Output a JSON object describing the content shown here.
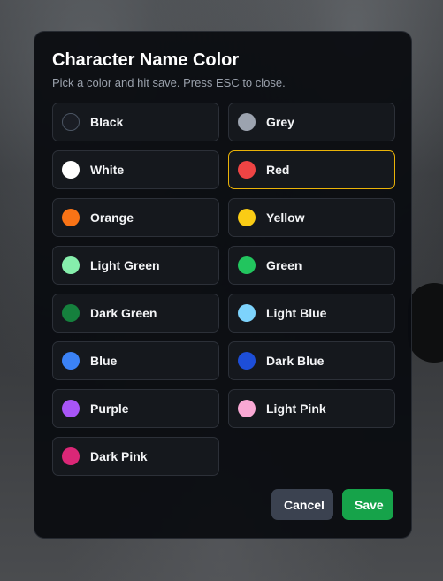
{
  "modal": {
    "title": "Character Name Color",
    "subtitle": "Pick a color and hit save. Press ESC to close.",
    "options": [
      {
        "label": "Black",
        "color": "#1a1d24",
        "outlined": true,
        "selected": false
      },
      {
        "label": "Grey",
        "color": "#9ca3af",
        "outlined": false,
        "selected": false
      },
      {
        "label": "White",
        "color": "#ffffff",
        "outlined": false,
        "selected": false
      },
      {
        "label": "Red",
        "color": "#ef4444",
        "outlined": false,
        "selected": true
      },
      {
        "label": "Orange",
        "color": "#f97316",
        "outlined": false,
        "selected": false
      },
      {
        "label": "Yellow",
        "color": "#facc15",
        "outlined": false,
        "selected": false
      },
      {
        "label": "Light Green",
        "color": "#86efac",
        "outlined": false,
        "selected": false
      },
      {
        "label": "Green",
        "color": "#22c55e",
        "outlined": false,
        "selected": false
      },
      {
        "label": "Dark Green",
        "color": "#15803d",
        "outlined": false,
        "selected": false
      },
      {
        "label": "Light Blue",
        "color": "#7dd3fc",
        "outlined": false,
        "selected": false
      },
      {
        "label": "Blue",
        "color": "#3b82f6",
        "outlined": false,
        "selected": false
      },
      {
        "label": "Dark Blue",
        "color": "#1d4ed8",
        "outlined": false,
        "selected": false
      },
      {
        "label": "Purple",
        "color": "#a855f7",
        "outlined": false,
        "selected": false
      },
      {
        "label": "Light Pink",
        "color": "#f9a8d4",
        "outlined": false,
        "selected": false
      },
      {
        "label": "Dark Pink",
        "color": "#db2777",
        "outlined": false,
        "selected": false
      }
    ],
    "cancel_label": "Cancel",
    "save_label": "Save",
    "colors": {
      "selected_border": "#eab308",
      "save_button": "#16a34a",
      "cancel_button": "#3b4250"
    }
  }
}
